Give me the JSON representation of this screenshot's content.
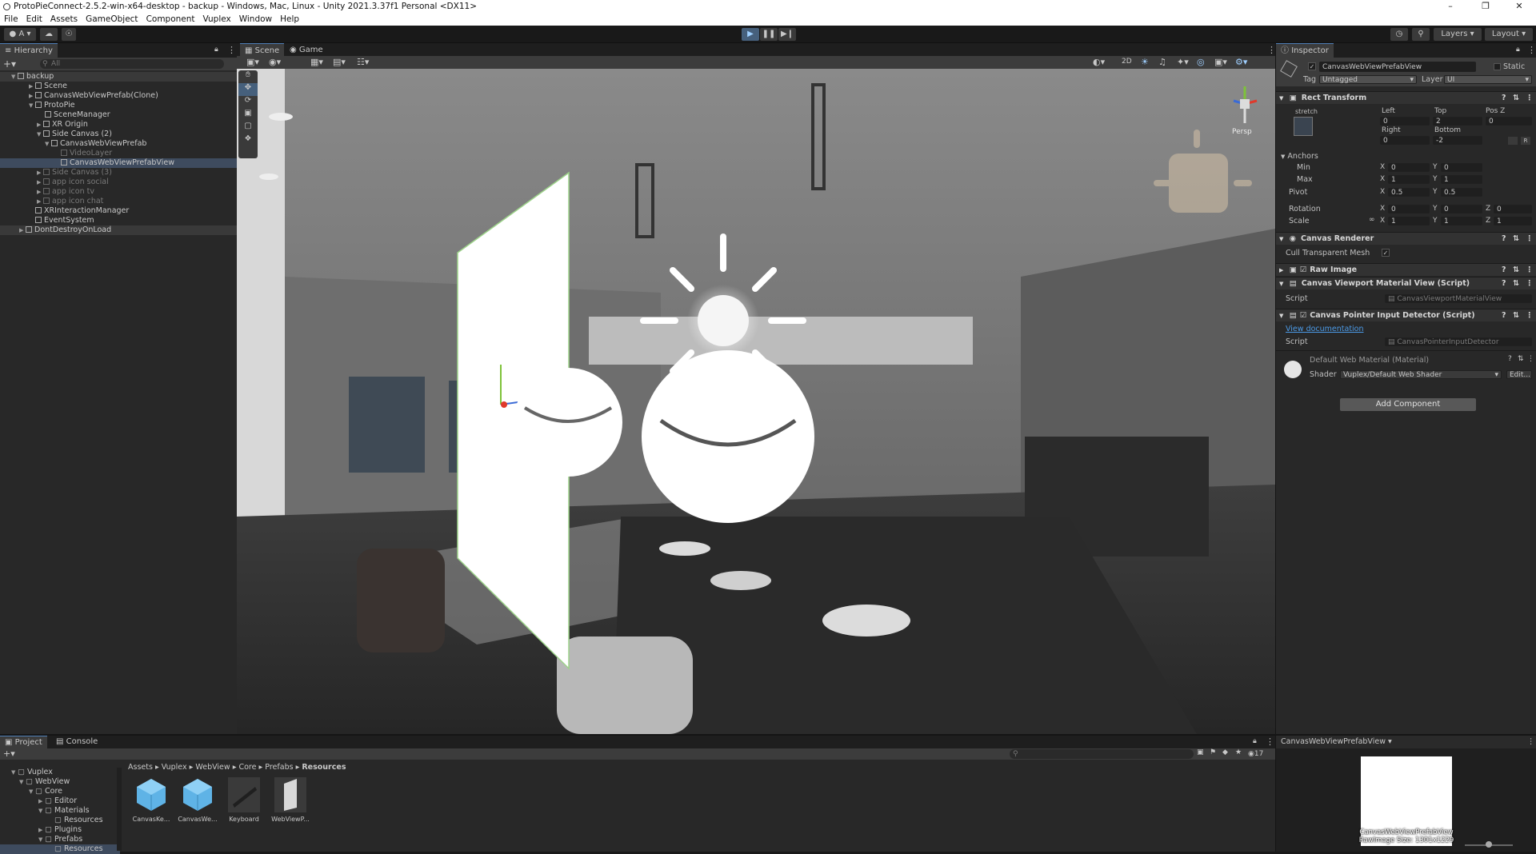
{
  "window": {
    "title": "ProtoPieConnect-2.5.2-win-x64-desktop - backup - Windows, Mac, Linux - Unity 2021.3.37f1 Personal <DX11>"
  },
  "menu": [
    "File",
    "Edit",
    "Assets",
    "GameObject",
    "Component",
    "Vuplex",
    "Window",
    "Help"
  ],
  "toolbar": {
    "account": "A",
    "layers": "Layers",
    "layout": "Layout"
  },
  "hierarchy": {
    "tab": "Hierarchy",
    "search_placeholder": "All",
    "items": [
      {
        "label": "backup",
        "depth": 0
      },
      {
        "label": "Scene",
        "depth": 1
      },
      {
        "label": "CanvasWebViewPrefab(Clone)",
        "depth": 1
      },
      {
        "label": "ProtoPie",
        "depth": 1
      },
      {
        "label": "SceneManager",
        "depth": 2
      },
      {
        "label": "XR Origin",
        "depth": 2
      },
      {
        "label": "Side Canvas (2)",
        "depth": 2
      },
      {
        "label": "CanvasWebViewPrefab",
        "depth": 3
      },
      {
        "label": "VideoLayer",
        "depth": 4
      },
      {
        "label": "CanvasWebViewPrefabView",
        "depth": 4
      },
      {
        "label": "Side Canvas (3)",
        "depth": 2
      },
      {
        "label": "app icon social",
        "depth": 2
      },
      {
        "label": "app icon tv",
        "depth": 2
      },
      {
        "label": "app icon chat",
        "depth": 2
      },
      {
        "label": "XRInteractionManager",
        "depth": 1
      },
      {
        "label": "EventSystem",
        "depth": 1
      },
      {
        "label": "DontDestroyOnLoad",
        "depth": 0
      }
    ]
  },
  "scene": {
    "tabs": [
      "Scene",
      "Game"
    ],
    "persp_label": "Persp",
    "mode_2d": "2D"
  },
  "inspector": {
    "tab": "Inspector",
    "object_name": "CanvasWebViewPrefabView",
    "static_label": "Static",
    "tag_label": "Tag",
    "tag_value": "Untagged",
    "layer_label": "Layer",
    "layer_value": "UI",
    "rect_transform": {
      "header": "Rect Transform",
      "stretch": "stretch",
      "left_label": "Left",
      "left": "0",
      "top_label": "Top",
      "top": "2",
      "posz_label": "Pos Z",
      "posz": "0",
      "right_label": "Right",
      "right": "0",
      "bottom_label": "Bottom",
      "bottom": "-2",
      "anchors_label": "Anchors",
      "min_label": "Min",
      "min_x": "0",
      "min_y": "0",
      "max_label": "Max",
      "max_x": "1",
      "max_y": "1",
      "pivot_label": "Pivot",
      "pivot_x": "0.5",
      "pivot_y": "0.5",
      "rotation_label": "Rotation",
      "rot_x": "0",
      "rot_y": "0",
      "rot_z": "0",
      "scale_label": "Scale",
      "scale_x": "1",
      "scale_y": "1",
      "scale_z": "1"
    },
    "canvas_renderer": {
      "header": "Canvas Renderer",
      "cull_label": "Cull Transparent Mesh"
    },
    "raw_image": {
      "header": "Raw Image"
    },
    "viewport_material": {
      "header": "Canvas Viewport Material View (Script)",
      "script_label": "Script",
      "script_value": "CanvasViewportMaterialView"
    },
    "pointer_detector": {
      "header": "Canvas Pointer Input Detector (Script)",
      "doc_link": "View documentation",
      "script_label": "Script",
      "script_value": "CanvasPointerInputDetector"
    },
    "material": {
      "name": "Default Web Material (Material)",
      "shader_label": "Shader",
      "shader_value": "Vuplex/Default Web Shader",
      "edit_label": "Edit..."
    },
    "add_component": "Add Component"
  },
  "project": {
    "tabs": [
      "Project",
      "Console"
    ],
    "tree": [
      {
        "label": "Vuplex",
        "depth": 0
      },
      {
        "label": "WebView",
        "depth": 1
      },
      {
        "label": "Core",
        "depth": 2
      },
      {
        "label": "Editor",
        "depth": 3
      },
      {
        "label": "Materials",
        "depth": 3
      },
      {
        "label": "Resources",
        "depth": 4
      },
      {
        "label": "Plugins",
        "depth": 3
      },
      {
        "label": "Prefabs",
        "depth": 3
      },
      {
        "label": "Resources",
        "depth": 4
      }
    ],
    "breadcrumb": [
      "Assets",
      "Vuplex",
      "WebView",
      "Core",
      "Prefabs",
      "Resources"
    ],
    "assets": [
      "CanvasKe...",
      "CanvasWe...",
      "Keyboard",
      "WebViewP..."
    ],
    "hidden_count": "17"
  },
  "preview": {
    "title": "CanvasWebViewPrefabView",
    "caption1": "CanvasWebViewPrefabView",
    "caption2": "RawImage Size: 1301x1229"
  },
  "colors": {
    "accent": "#4f7eb6",
    "panel": "#282828",
    "selection": "#3e4b5e",
    "link": "#4c9be8"
  }
}
